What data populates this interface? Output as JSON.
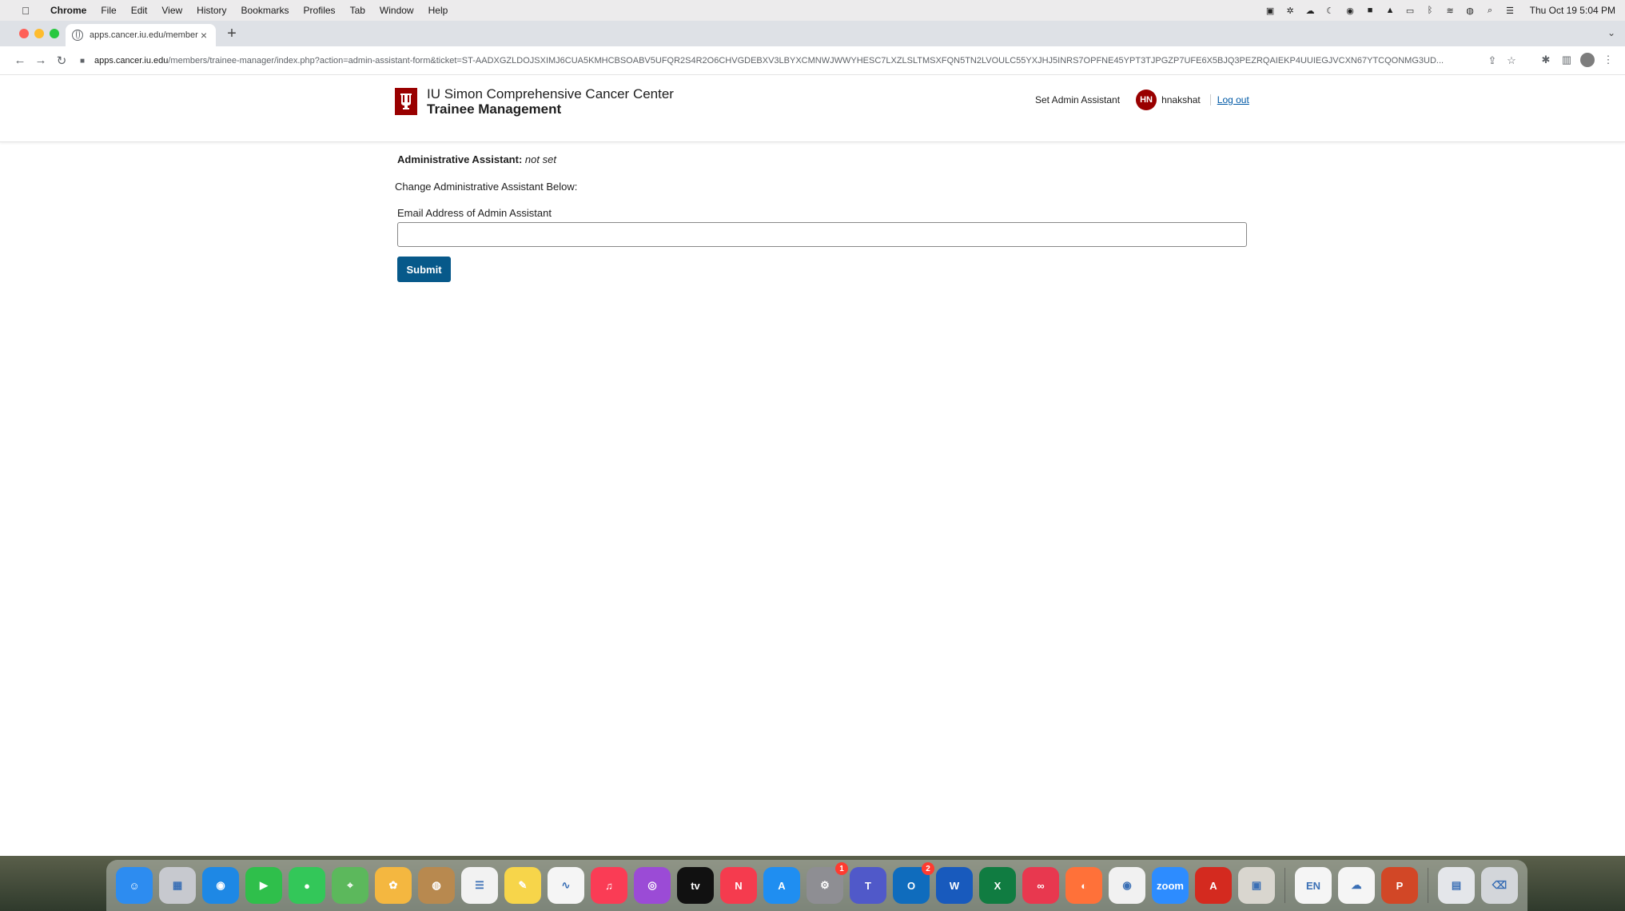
{
  "menubar": {
    "app_name": "Chrome",
    "items": [
      "File",
      "Edit",
      "View",
      "History",
      "Bookmarks",
      "Profiles",
      "Tab",
      "Window",
      "Help"
    ],
    "clock": "Thu Oct 19  5:04 PM"
  },
  "browser": {
    "tab_title": "apps.cancer.iu.edu/members/",
    "url_host": "apps.cancer.iu.edu",
    "url_path": "/members/trainee-manager/index.php?action=admin-assistant-form&ticket=ST-AADXGZLDOJSXIMJ6CUA5KMHCBSOABV5UFQR2S4R2O6CHVGDEBXV3LBYXCMNWJWWYHESC7LXZLSLTMSXFQN5TN2LVOULC55YXJHJ5INRS7OPFNE45YPT3TJPGZP7UFE6X5BJQ3PEZRQAIEKP4UUIEGJVCXN67YTCQONMG3UD..."
  },
  "site": {
    "org_name": "IU Simon Comprehensive Cancer Center",
    "app_name": "Trainee Management",
    "nav": {
      "set_admin": "Set Admin Assistant",
      "avatar_initials": "HN",
      "username": "hnakshat",
      "logout": "Log out"
    },
    "brand_color": "#990000",
    "link_color": "#0059a6"
  },
  "form": {
    "status_label": "Administrative Assistant:",
    "status_value": "not set",
    "change_label": "Change Administrative Assistant Below:",
    "email_label": "Email Address of Admin Assistant",
    "email_value": "",
    "email_placeholder": "",
    "submit_label": "Submit",
    "submit_color": "#07598a"
  },
  "dock": {
    "apps": [
      {
        "name": "finder-icon",
        "bg": "#2d8cf0",
        "glyph": "☺"
      },
      {
        "name": "launchpad-icon",
        "bg": "#c7c9cf",
        "glyph": "▦"
      },
      {
        "name": "safari-icon",
        "bg": "#1e88e5",
        "glyph": "◉"
      },
      {
        "name": "facetime-icon",
        "bg": "#2fbf4b",
        "glyph": "▶"
      },
      {
        "name": "messages-icon",
        "bg": "#33c759",
        "glyph": "●"
      },
      {
        "name": "maps-icon",
        "bg": "#5cb85c",
        "glyph": "⌖"
      },
      {
        "name": "photos-icon",
        "bg": "#f4b740",
        "glyph": "✿"
      },
      {
        "name": "contacts-icon",
        "bg": "#b8894f",
        "glyph": "◍"
      },
      {
        "name": "reminders-icon",
        "bg": "#f2f2f2",
        "glyph": "☰"
      },
      {
        "name": "notes-icon",
        "bg": "#f7d54a",
        "glyph": "✎"
      },
      {
        "name": "freeform-icon",
        "bg": "#f5f5f5",
        "glyph": "∿"
      },
      {
        "name": "music-icon",
        "bg": "#fa3c55",
        "glyph": "♫"
      },
      {
        "name": "podcasts-icon",
        "bg": "#9b4bd6",
        "glyph": "◎"
      },
      {
        "name": "apple-tv-icon",
        "bg": "#111111",
        "glyph": "tv"
      },
      {
        "name": "news-icon",
        "bg": "#f53b4e",
        "glyph": "N"
      },
      {
        "name": "app-store-icon",
        "bg": "#1f8ef1",
        "glyph": "A"
      },
      {
        "name": "system-settings-icon",
        "bg": "#8e8e93",
        "glyph": "⚙",
        "badge": "1"
      },
      {
        "name": "teams-icon",
        "bg": "#5059c9",
        "glyph": "T"
      },
      {
        "name": "outlook-icon",
        "bg": "#0f6cbd",
        "glyph": "O",
        "badge": "2"
      },
      {
        "name": "word-icon",
        "bg": "#185abd",
        "glyph": "W"
      },
      {
        "name": "excel-icon",
        "bg": "#107c41",
        "glyph": "X"
      },
      {
        "name": "creative-cloud-icon",
        "bg": "#e8384f",
        "glyph": "∞"
      },
      {
        "name": "firefox-icon",
        "bg": "#ff7139",
        "glyph": "◐"
      },
      {
        "name": "chrome-icon",
        "bg": "#f1f1f1",
        "glyph": "◉"
      },
      {
        "name": "zoom-icon",
        "bg": "#2d8cff",
        "glyph": "zoom"
      },
      {
        "name": "acrobat-icon",
        "bg": "#d42a1f",
        "glyph": "A"
      },
      {
        "name": "preview-icon",
        "bg": "#d9d6cf",
        "glyph": "▣"
      },
      {
        "name": "endnote-icon",
        "bg": "#f5f5f5",
        "glyph": "EN"
      },
      {
        "name": "onedrive-icon",
        "bg": "#f5f5f5",
        "glyph": "☁"
      },
      {
        "name": "powerpoint-icon",
        "bg": "#d24726",
        "glyph": "P"
      },
      {
        "name": "downloads-stack-icon",
        "bg": "#e4e6ea",
        "glyph": "▤"
      },
      {
        "name": "trash-icon",
        "bg": "#d3d6da",
        "glyph": "⌫"
      }
    ]
  }
}
